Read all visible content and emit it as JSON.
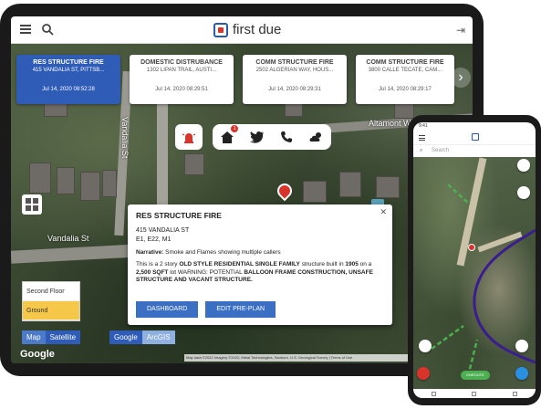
{
  "app": {
    "brand": "first due"
  },
  "incidents": [
    {
      "type": "RES STRUCTURE FIRE",
      "address": "415 VANDALIA ST, PITTSB...",
      "time": "Jul 14, 2020 08:52:28",
      "active": true
    },
    {
      "type": "DOMESTIC DISTRUBANCE",
      "address": "1302 LIPAN TRAIL, AUSTI...",
      "time": "Jul 14, 2020 08:29:51",
      "active": false
    },
    {
      "type": "COMM STRUCTURE FIRE",
      "address": "2502 ALGERIAN WAY, HOUS...",
      "time": "Jul 14, 2020 08:29:31",
      "active": false
    },
    {
      "type": "COMM STRUCTURE FIRE",
      "address": "3800 CALLE TECATE, CAM...",
      "time": "Jul 14, 2020 08:29:17",
      "active": false
    }
  ],
  "map": {
    "streets": [
      "Vandalia St",
      "Altamont Way"
    ],
    "floor_levels": [
      "Second Floor",
      "Ground"
    ],
    "selected_floor": "Ground",
    "map_type": {
      "map": "Map",
      "satellite": "Satellite"
    },
    "provider": {
      "google": "Google",
      "arcgis": "ArcGIS"
    },
    "google_logo": "Google",
    "attribution": "Map data ©2022 Imagery ©2022, Metal Technologies, Sanborn, U.S. Geological Survey | Terms of Use",
    "notification_count": "1"
  },
  "popup": {
    "title": "RES STRUCTURE FIRE",
    "address": "415 VANDALIA ST",
    "units": "E1, E22, M1",
    "narrative_label": "Narrative:",
    "narrative": "Smoke and Flames showing multiple callers",
    "desc_1": "This is a 2 story ",
    "desc_2": "OLD STYLE RESIDENTIAL SINGLE FAMILY",
    "desc_3": " structure built in ",
    "desc_4": "1905",
    "desc_5": " on a ",
    "desc_6": "2,500 SQFT",
    "desc_7": " lot WARNING: POTENTIAL ",
    "desc_8": "BALLOON FRAME CONSTRUCTION, UNSAFE STRUCTURE AND VACANT STRUCTURE.",
    "dashboard_label": "DASHBOARD",
    "edit_label": "EDIT PRE-PLAN",
    "close_label": "✕"
  },
  "phone": {
    "status_time": "9:41",
    "search_placeholder": "Search",
    "status_pill": "ENROUTE"
  },
  "colors": {
    "accent": "#2f5cb7",
    "alert": "#d9342b"
  }
}
